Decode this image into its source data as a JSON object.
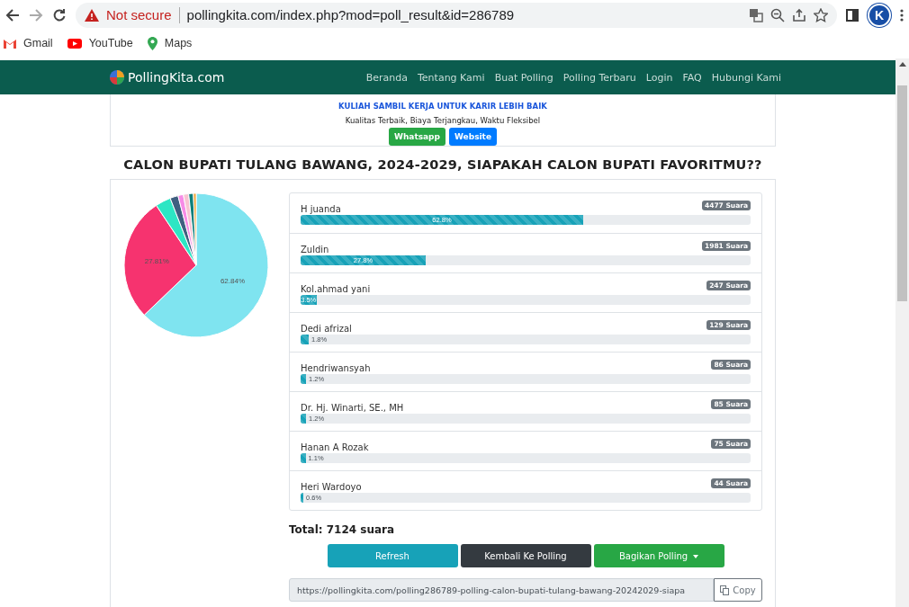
{
  "browser": {
    "security": "Not secure",
    "url": "pollingkita.com/index.php?mod=poll_result&id=286789",
    "bookmarks": [
      {
        "label": "Gmail",
        "kind": "gmail"
      },
      {
        "label": "YouTube",
        "kind": "youtube"
      },
      {
        "label": "Maps",
        "kind": "maps"
      }
    ],
    "profile": "K"
  },
  "nav": {
    "brand": "PollingKita.com",
    "links": [
      "Beranda",
      "Tentang Kami",
      "Buat Polling",
      "Polling Terbaru",
      "Login",
      "FAQ",
      "Hubungi Kami"
    ]
  },
  "ad": {
    "headline": "KULIAH SAMBIL KERJA UNTUK KARIR LEBIH BAIK",
    "tagline": "Kualitas Terbaik, Biaya Terjangkau, Waktu Fleksibel",
    "buttons": [
      {
        "label": "Whatsapp",
        "kind": "whatsapp"
      },
      {
        "label": "Website",
        "kind": "website"
      }
    ]
  },
  "poll": {
    "title": "CALON BUPATI TULANG BAWANG, 2024-2029, SIAPAKAH CALON BUPATI FAVORITMU??",
    "chart_data": {
      "type": "pie",
      "values": [
        62.84,
        27.81,
        3.47,
        1.81,
        1.21,
        1.19,
        1.05,
        0.62
      ],
      "colors": [
        "#7fe4f0",
        "#f6336f",
        "#2de6c4",
        "#3f5f80",
        "#f78be6",
        "#f8c3d2",
        "#0e7f7a",
        "#f0a433"
      ],
      "value_labels": [
        "62.84%",
        "27.81%",
        null,
        null,
        null,
        null,
        null,
        null
      ]
    },
    "options": [
      {
        "name": "H juanda",
        "votes": "4477 Suara",
        "percent": "62.8%",
        "level": 0.628
      },
      {
        "name": "Zuldin",
        "votes": "1981 Suara",
        "percent": "27.8%",
        "level": 0.278
      },
      {
        "name": "Kol.ahmad yani",
        "votes": "247 Suara",
        "percent": "3.5%",
        "level": 0.035
      },
      {
        "name": "Dedi afrizal",
        "votes": "129 Suara",
        "percent": "1.8%",
        "level": 0.018
      },
      {
        "name": "Hendriwansyah",
        "votes": "86 Suara",
        "percent": "1.2%",
        "level": 0.012
      },
      {
        "name": "Dr. Hj. Winarti, SE., MH",
        "votes": "85 Suara",
        "percent": "1.2%",
        "level": 0.012
      },
      {
        "name": "Hanan A Rozak",
        "votes": "75 Suara",
        "percent": "1.1%",
        "level": 0.011
      },
      {
        "name": "Heri Wardoyo",
        "votes": "44 Suara",
        "percent": "0.6%",
        "level": 0.006
      }
    ],
    "total": "Total: 7124 suara",
    "buttons": [
      {
        "label": "Refresh",
        "kind": "refresh"
      },
      {
        "label": "Kembali Ke Polling",
        "kind": "back"
      },
      {
        "label": "Bagikan Polling",
        "kind": "share"
      }
    ],
    "share_url": "https://pollingkita.com/polling286789-polling-calon-bupati-tulang-bawang-20242029-siapa",
    "copy_label": "Copy"
  }
}
